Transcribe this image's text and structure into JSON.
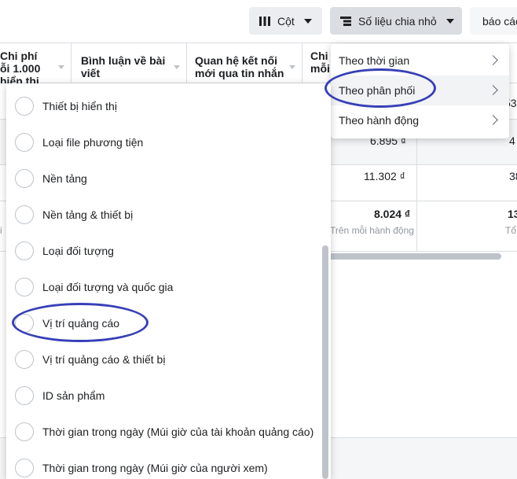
{
  "toolbar": {
    "columns_label": "Cột",
    "breakdown_label": "Số liệu chia nhỏ",
    "reports_label": "báo cáo"
  },
  "table": {
    "headers": [
      "Chi phí\nỗi 1.000\nhiển thị",
      "Bình luận về bài\nviết",
      "Quan hệ kết nối\nmới qua tin nhắn",
      "Chi\nmỗi"
    ],
    "rows": [
      {
        "right_value": "5",
        "right_full": "53"
      },
      {
        "value": "6.895 ₫",
        "right_full": "4"
      },
      {
        "value": "11.302 ₫",
        "right_full": "38"
      },
      {
        "value": "8.024 ₫",
        "sub": "Trên mỗi hành động",
        "left_sub": "i",
        "right_full": "13",
        "right_sub": "Tổ"
      }
    ]
  },
  "submenu": {
    "items": [
      {
        "label": "Theo thời gian"
      },
      {
        "label": "Theo phân phối"
      },
      {
        "label": "Theo hành động"
      }
    ]
  },
  "breakdown_list": {
    "items": [
      {
        "label": "Thiết bị hiển thị"
      },
      {
        "label": "Loại file phương tiện"
      },
      {
        "label": "Nền tảng"
      },
      {
        "label": "Nền tảng & thiết bị"
      },
      {
        "label": "Loại đối tượng"
      },
      {
        "label": "Loại đối tượng và quốc gia"
      },
      {
        "label": "Vị trí quảng cáo"
      },
      {
        "label": "Vị trí quảng cáo & thiết bị"
      },
      {
        "label": "ID sản phẩm"
      },
      {
        "label": "Thời gian trong ngày (Múi giờ của tài khoản quảng cáo)"
      },
      {
        "label": "Thời gian trong ngày (Múi giờ của người xem)"
      }
    ]
  },
  "colors": {
    "annotation": "#3740b6",
    "button_bg": "#ebedf0",
    "border": "#dadde1"
  },
  "icons": {
    "columns": "columns-icon",
    "breakdown": "breakdown-icon"
  }
}
